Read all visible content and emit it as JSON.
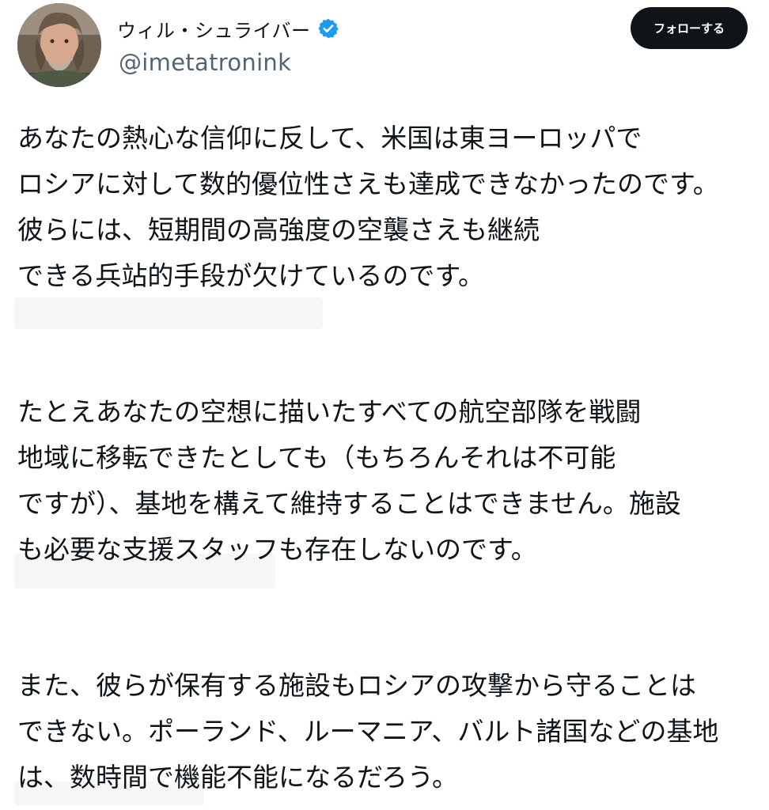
{
  "author": {
    "display_name": "ウィル・シュライバー",
    "handle": "@imetatronink",
    "verified_icon": "verified-badge-icon",
    "avatar_icon": "profile-photo"
  },
  "follow_button": {
    "label": "フォローする"
  },
  "colors": {
    "button_bg": "#0f1419",
    "verified_blue": "#1d9bf0",
    "handle_gray": "#536471"
  },
  "tweet": {
    "paragraphs": [
      {
        "lines": [
          "あなたの熱心な信仰に反して、米国は東ヨーロッパで",
          "ロシアに対して数的優位性さえも達成できなかったのです。",
          "彼らには、短期間の高強度の空襲さえも継続",
          "できる兵站的手段が欠けているのです。"
        ]
      },
      {
        "lines": [
          "たとえあなたの空想に描いたすべての航空部隊を戦闘",
          "地域に移転できたとしても（もちろんそれは不可能",
          "ですが）、基地を構えて維持することはできません。施設",
          "も必要な支援スタッフも存在しないのです。"
        ]
      },
      {
        "lines": [
          "また、彼らが保有する施設もロシアの攻撃から守ることは",
          "できない。ポーランド、ルーマニア、バルト諸国などの基地",
          "は、数時間で機能不能になるだろう。"
        ]
      }
    ]
  }
}
